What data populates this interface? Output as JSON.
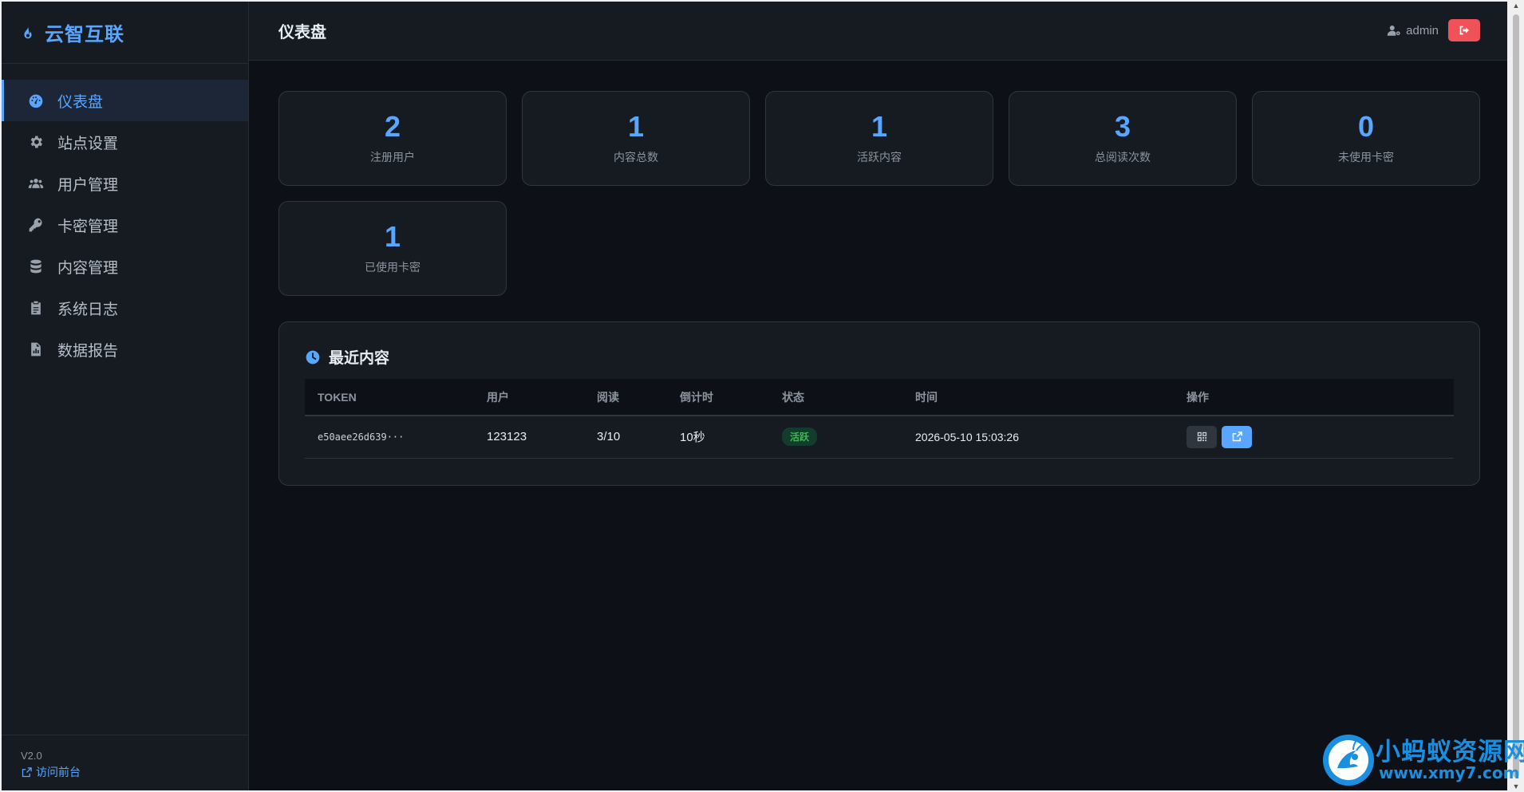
{
  "sidebar": {
    "brand_name": "云智互联",
    "items": [
      {
        "label": "仪表盘",
        "icon": "dashboard-icon",
        "active": true
      },
      {
        "label": "站点设置",
        "icon": "gear-icon"
      },
      {
        "label": "用户管理",
        "icon": "users-icon"
      },
      {
        "label": "卡密管理",
        "icon": "key-icon"
      },
      {
        "label": "内容管理",
        "icon": "database-icon"
      },
      {
        "label": "系统日志",
        "icon": "clipboard-icon"
      },
      {
        "label": "数据报告",
        "icon": "file-chart-icon"
      }
    ],
    "version": "V2.0",
    "visit_label": "访问前台"
  },
  "header": {
    "title": "仪表盘",
    "username": "admin"
  },
  "stats": [
    {
      "value": "2",
      "label": "注册用户"
    },
    {
      "value": "1",
      "label": "内容总数"
    },
    {
      "value": "1",
      "label": "活跃内容"
    },
    {
      "value": "3",
      "label": "总阅读次数"
    },
    {
      "value": "0",
      "label": "未使用卡密"
    },
    {
      "value": "1",
      "label": "已使用卡密"
    }
  ],
  "recent": {
    "title": "最近内容",
    "columns": [
      "TOKEN",
      "用户",
      "阅读",
      "倒计时",
      "状态",
      "时间",
      "操作"
    ],
    "rows": [
      {
        "token": "e50aee26d639···",
        "user": "123123",
        "reads": "3/10",
        "countdown": "10秒",
        "status": "活跃",
        "time": "2026-05-10 15:03:26"
      }
    ]
  },
  "watermark": {
    "cn": "小蚂蚁资源网",
    "url": "www.xmy7.com"
  },
  "colors": {
    "accent": "#58a6ff",
    "background": "#0d1117",
    "panel": "#161b22",
    "danger": "#f0525a",
    "success": "#3fb950"
  }
}
